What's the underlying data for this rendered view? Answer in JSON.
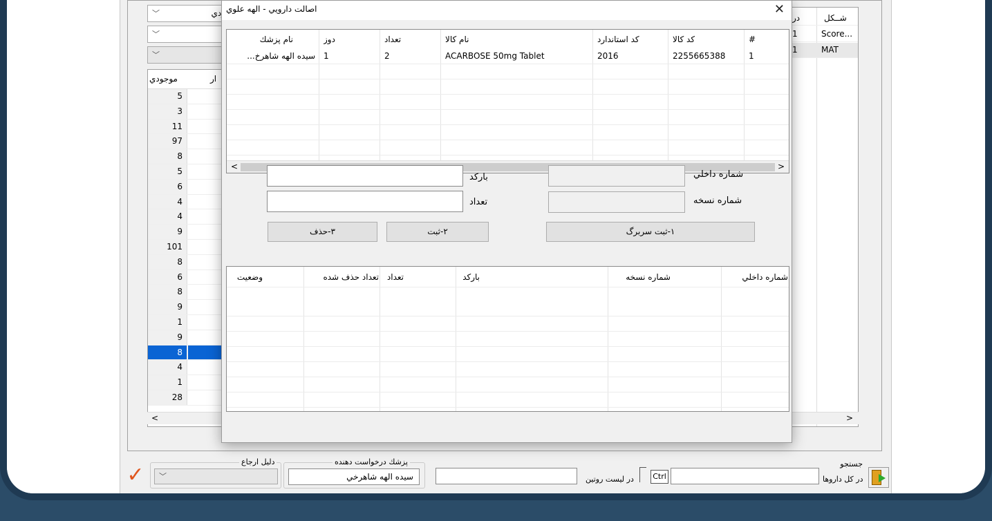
{
  "background_panel": {
    "combo_top_text": "ودي",
    "left_grid": {
      "header_left": "موجودي",
      "header_right": "ار",
      "values": [
        "5",
        "3",
        "11",
        "97",
        "8",
        "5",
        "6",
        "4",
        "4",
        "9",
        "101",
        "8",
        "6",
        "8",
        "9",
        "1",
        "9",
        "8",
        "4",
        "1",
        "28"
      ],
      "selected_index": 17
    },
    "right_grid": {
      "header_col1": "در",
      "header_col2": "شــكل",
      "rows": [
        {
          "c1": "1",
          "c2": "Score..."
        },
        {
          "c1": "1",
          "c2": "MAT"
        }
      ]
    },
    "scroll_left": "<",
    "scroll_right": ">"
  },
  "dialog": {
    "title": "اصالت دارويي - الهه علوي",
    "close": "✕",
    "top_grid": {
      "headers": {
        "num": "#",
        "code": "كد كالا",
        "std_code": "كد استاندارد",
        "name": "نام كالا",
        "count": "تعداد",
        "dose": "دوز",
        "doctor": "نام پزشك"
      },
      "rows": [
        {
          "num": "1",
          "code": "2255665388",
          "std_code": "2016",
          "name": "ACARBOSE 50mg Tablet",
          "count": "2",
          "dose": "1",
          "doctor": "سيده الهه شاهرخ..."
        }
      ],
      "scroll_left": "<",
      "scroll_right": ">"
    },
    "form": {
      "internal_no_label": "شماره داخلي",
      "prescription_no_label": "شماره نسخه",
      "barcode_label": "باركد",
      "count_label": "تعداد",
      "btn_register_header": "۱-ثبت سربرگ",
      "btn_register": "۲-ثبت",
      "btn_delete": "۳-حذف"
    },
    "bottom_grid": {
      "headers": {
        "internal_no": "شماره داخلي",
        "prescription_no": "شماره نسخه",
        "barcode": "باركد",
        "count": "تعداد",
        "deleted_count": "تعداد حذف شده",
        "status": "وضعيت"
      }
    }
  },
  "bottom_bar": {
    "search_label": "جستجو",
    "all_drugs_label": "در كل داروها",
    "ctrl_label": "Ctrl",
    "routine_list_label": "در ليست روتين",
    "requesting_doctor_label": "پزشك درخواست دهنده",
    "requesting_doctor_value": "سيده الهه  شاهرخي",
    "referral_reason_label": "دليل ارجاع"
  }
}
